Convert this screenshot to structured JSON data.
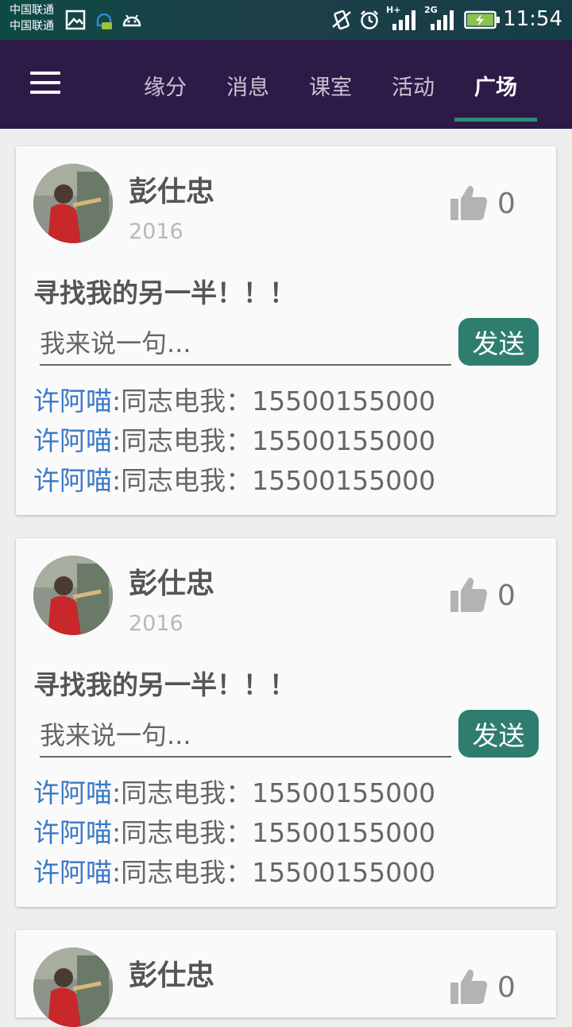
{
  "status_bar": {
    "carrier_1": "中国联通",
    "carrier_2": "中国联通",
    "network_label_1": "H+",
    "network_label_2": "2G",
    "time": "11:54",
    "icons": [
      "image-icon",
      "notification-icon",
      "android-icon",
      "vibrate-icon",
      "alarm-icon",
      "signal-icon",
      "signal-icon",
      "battery-charging-icon"
    ]
  },
  "appbar": {
    "menu_icon": "hamburger-menu-icon",
    "tabs": [
      {
        "label": "缘分"
      },
      {
        "label": "消息"
      },
      {
        "label": "课室"
      },
      {
        "label": "活动"
      },
      {
        "label": "广场",
        "active": true
      }
    ],
    "accent_color": "#2e8a78",
    "background_color": "#2e1a47"
  },
  "posts": [
    {
      "author": "彭仕忠",
      "date": "2016",
      "likes": "0",
      "text": "寻找我的另一半！！！",
      "comment_placeholder": "我来说一句...",
      "send_label": "发送",
      "comments": [
        {
          "user": "许阿喵",
          "text": ":同志电我：15500155000"
        },
        {
          "user": "许阿喵",
          "text": ":同志电我：15500155000"
        },
        {
          "user": "许阿喵",
          "text": ":同志电我：15500155000"
        }
      ]
    },
    {
      "author": "彭仕忠",
      "date": "2016",
      "likes": "0",
      "text": "寻找我的另一半！！！",
      "comment_placeholder": "我来说一句...",
      "send_label": "发送",
      "comments": [
        {
          "user": "许阿喵",
          "text": ":同志电我：15500155000"
        },
        {
          "user": "许阿喵",
          "text": ":同志电我：15500155000"
        },
        {
          "user": "许阿喵",
          "text": ":同志电我：15500155000"
        }
      ]
    },
    {
      "author": "彭仕忠",
      "likes": "0"
    }
  ],
  "colors": {
    "send_button": "#2e7d6e",
    "commenter_name": "#3a78c8"
  }
}
